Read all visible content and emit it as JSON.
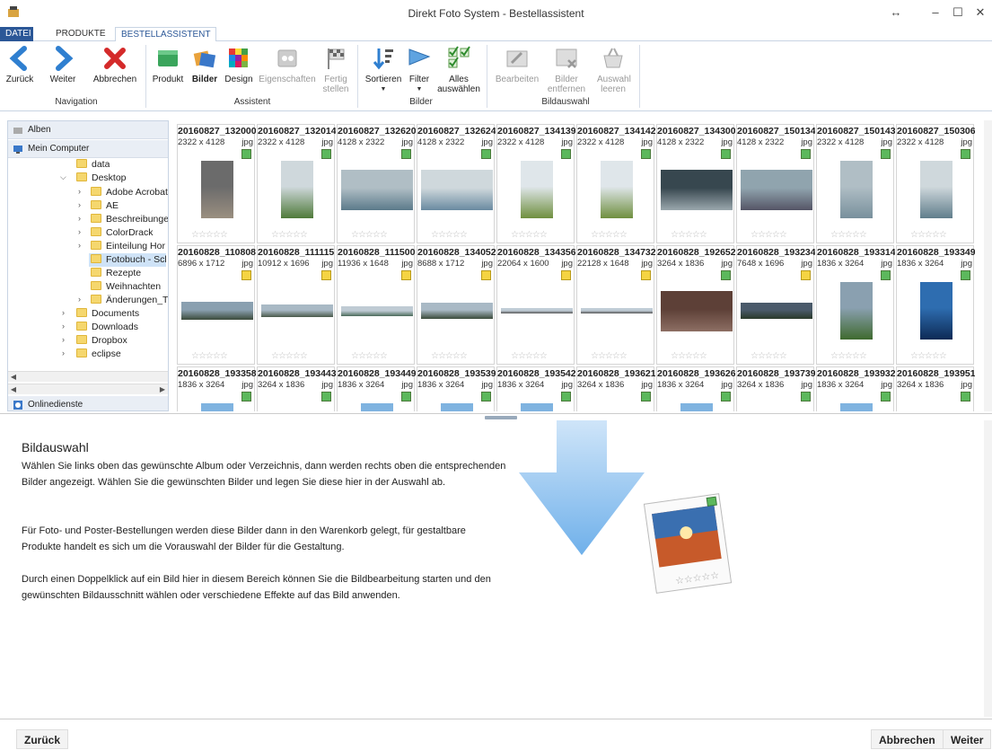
{
  "window": {
    "title": "Direkt Foto System - Bestellassistent",
    "controls": [
      "↔",
      "–",
      "☐",
      "✕"
    ]
  },
  "tabs": [
    "DATEI",
    "PRODUKTE",
    "BESTELLASSISTENT"
  ],
  "ribbon": {
    "navigation": {
      "label": "Navigation",
      "buttons": [
        "Zurück",
        "Weiter",
        "Abbrechen"
      ]
    },
    "assistent": {
      "label": "Assistent",
      "buttons": [
        "Produkt",
        "Bilder",
        "Design",
        "Eigenschaften",
        "Fertig stellen"
      ]
    },
    "bilder": {
      "label": "Bilder",
      "buttons": [
        "Sortieren",
        "Filter",
        "Alles auswählen"
      ]
    },
    "bildauswahl": {
      "label": "Bildauswahl",
      "buttons": [
        "Bearbeiten",
        "Bilder entfernen",
        "Auswahl leeren"
      ]
    }
  },
  "sidebar": {
    "alben": "Alben",
    "mein_computer": "Mein Computer",
    "onlinedienste": "Onlinedienste",
    "tree": [
      "data",
      "Desktop",
      "Adobe Acrobat",
      "AE",
      "Beschreibunge",
      "ColorDrack",
      "Einteilung Hor",
      "Fotobuch - Scl",
      "Rezepte",
      "Weihnachten",
      "Änderungen_T",
      "Documents",
      "Downloads",
      "Dropbox",
      "eclipse"
    ]
  },
  "photos": [
    {
      "name": "20160827_132000",
      "dims": "2322 x 4128",
      "ext": "jpg",
      "flag": "green",
      "stars": "☆☆☆☆☆"
    },
    {
      "name": "20160827_132014",
      "dims": "2322 x 4128",
      "ext": "jpg",
      "flag": "green",
      "stars": "☆☆☆☆☆"
    },
    {
      "name": "20160827_132620",
      "dims": "4128 x 2322",
      "ext": "jpg",
      "flag": "green",
      "stars": "☆☆☆☆☆"
    },
    {
      "name": "20160827_132624",
      "dims": "4128 x 2322",
      "ext": "jpg",
      "flag": "green",
      "stars": "☆☆☆☆☆"
    },
    {
      "name": "20160827_134139",
      "dims": "2322 x 4128",
      "ext": "jpg",
      "flag": "green",
      "stars": "☆☆☆☆☆"
    },
    {
      "name": "20160827_134142",
      "dims": "2322 x 4128",
      "ext": "jpg",
      "flag": "green",
      "stars": "☆☆☆☆☆"
    },
    {
      "name": "20160827_134300",
      "dims": "4128 x 2322",
      "ext": "jpg",
      "flag": "green",
      "stars": "☆☆☆☆☆"
    },
    {
      "name": "20160827_150134",
      "dims": "4128 x 2322",
      "ext": "jpg",
      "flag": "green",
      "stars": "☆☆☆☆☆"
    },
    {
      "name": "20160827_150143",
      "dims": "2322 x 4128",
      "ext": "jpg",
      "flag": "green",
      "stars": "☆☆☆☆☆"
    },
    {
      "name": "20160827_150306",
      "dims": "2322 x 4128",
      "ext": "jpg",
      "flag": "green",
      "stars": "☆☆☆☆☆"
    },
    {
      "name": "20160828_110808",
      "dims": "6896 x 1712",
      "ext": "jpg",
      "flag": "yellow",
      "stars": "☆☆☆☆☆"
    },
    {
      "name": "20160828_111115",
      "dims": "10912 x 1696",
      "ext": "jpg",
      "flag": "yellow",
      "stars": "☆☆☆☆☆"
    },
    {
      "name": "20160828_111500",
      "dims": "11936 x 1648",
      "ext": "jpg",
      "flag": "yellow",
      "stars": "☆☆☆☆☆"
    },
    {
      "name": "20160828_134052",
      "dims": "8688 x 1712",
      "ext": "jpg",
      "flag": "yellow",
      "stars": "☆☆☆☆☆"
    },
    {
      "name": "20160828_134356",
      "dims": "22064 x 1600",
      "ext": "jpg",
      "flag": "yellow",
      "stars": "☆☆☆☆☆"
    },
    {
      "name": "20160828_134732",
      "dims": "22128 x 1648",
      "ext": "jpg",
      "flag": "yellow",
      "stars": "☆☆☆☆☆"
    },
    {
      "name": "20160828_192652",
      "dims": "3264 x 1836",
      "ext": "jpg",
      "flag": "green",
      "stars": "☆☆☆☆☆"
    },
    {
      "name": "20160828_193234",
      "dims": "7648 x 1696",
      "ext": "jpg",
      "flag": "yellow",
      "stars": "☆☆☆☆☆"
    },
    {
      "name": "20160828_193314",
      "dims": "1836 x 3264",
      "ext": "jpg",
      "flag": "green",
      "stars": "☆☆☆☆☆"
    },
    {
      "name": "20160828_193349",
      "dims": "1836 x 3264",
      "ext": "jpg",
      "flag": "green",
      "stars": "☆☆☆☆☆"
    },
    {
      "name": "20160828_193358",
      "dims": "1836 x 3264",
      "ext": "jpg",
      "flag": "green",
      "stars": ""
    },
    {
      "name": "20160828_193443",
      "dims": "3264 x 1836",
      "ext": "jpg",
      "flag": "green",
      "stars": ""
    },
    {
      "name": "20160828_193449",
      "dims": "1836 x 3264",
      "ext": "jpg",
      "flag": "green",
      "stars": ""
    },
    {
      "name": "20160828_193539",
      "dims": "1836 x 3264",
      "ext": "jpg",
      "flag": "green",
      "stars": ""
    },
    {
      "name": "20160828_193542",
      "dims": "1836 x 3264",
      "ext": "jpg",
      "flag": "green",
      "stars": ""
    },
    {
      "name": "20160828_193621",
      "dims": "3264 x 1836",
      "ext": "jpg",
      "flag": "green",
      "stars": ""
    },
    {
      "name": "20160828_193626",
      "dims": "1836 x 3264",
      "ext": "jpg",
      "flag": "green",
      "stars": ""
    },
    {
      "name": "20160828_193739",
      "dims": "3264 x 1836",
      "ext": "jpg",
      "flag": "green",
      "stars": ""
    },
    {
      "name": "20160828_193932",
      "dims": "1836 x 3264",
      "ext": "jpg",
      "flag": "green",
      "stars": ""
    },
    {
      "name": "20160828_193951",
      "dims": "3264 x 1836",
      "ext": "jpg",
      "flag": "green",
      "stars": ""
    }
  ],
  "info": {
    "title": "Bildauswahl",
    "p1": "Wählen Sie links oben das gewünschte Album oder Verzeichnis, dann werden rechts oben die entsprechenden Bilder angezeigt. Wählen Sie die gewünschten Bilder und legen Sie diese hier in der Auswahl ab.",
    "p2": "Für Foto- und Poster-Bestellungen werden diese Bilder dann in den Warenkorb gelegt, für gestaltbare Produkte handelt es sich um die Vorauswahl der Bilder für die Gestaltung.",
    "p3": "Durch einen Doppelklick auf ein Bild hier in diesem Bereich können Sie die Bildbearbeitung starten und den gewünschten Bildausschnitt wählen oder verschiedene Effekte auf das Bild anwenden.",
    "graphic_stars": "☆☆☆☆☆"
  },
  "footer": {
    "back": "Zurück",
    "cancel": "Abbrechen",
    "next": "Weiter"
  },
  "colors": {
    "accent": "#2b5797",
    "flag_green": "#5cb85c",
    "flag_yellow": "#f5d442",
    "selection": "#cfe3f7"
  }
}
